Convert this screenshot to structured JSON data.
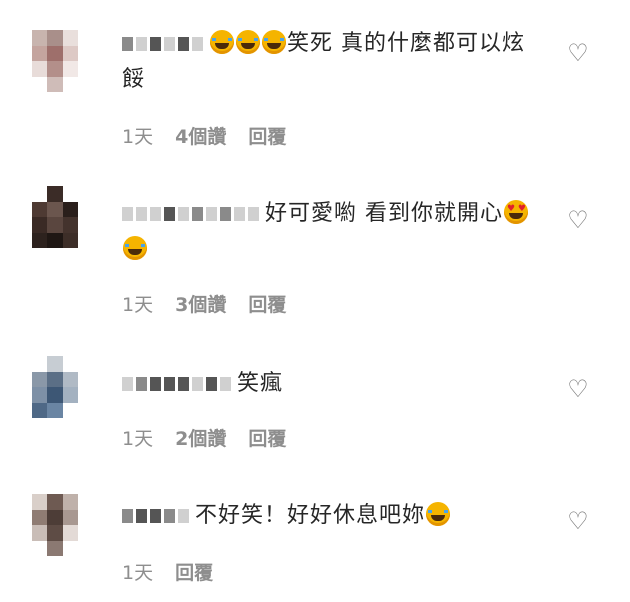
{
  "comments": [
    {
      "text": "笑死 真的什麼都可以炫餒",
      "emojis_before": [
        "face-with-tears-of-joy",
        "face-with-tears-of-joy",
        "face-with-tears-of-joy"
      ],
      "time": "1天",
      "likes": "4個讚",
      "reply": "回覆"
    },
    {
      "text": "好可愛喲 看到你就開心",
      "emojis_after": [
        "smiling-face-with-heart-eyes",
        "face-with-tears-of-joy"
      ],
      "time": "1天",
      "likes": "3個讚",
      "reply": "回覆"
    },
    {
      "text": "笑瘋",
      "time": "1天",
      "likes": "2個讚",
      "reply": "回覆"
    },
    {
      "text": "不好笑！好好休息吧妳",
      "emojis_after": [
        "face-with-tears-of-joy"
      ],
      "time": "1天",
      "reply": "回覆"
    }
  ],
  "like_icon": "heart-outline-icon",
  "colors": {
    "text": "#262626",
    "meta": "#8e8e8e",
    "emoji": "#f5b400"
  }
}
